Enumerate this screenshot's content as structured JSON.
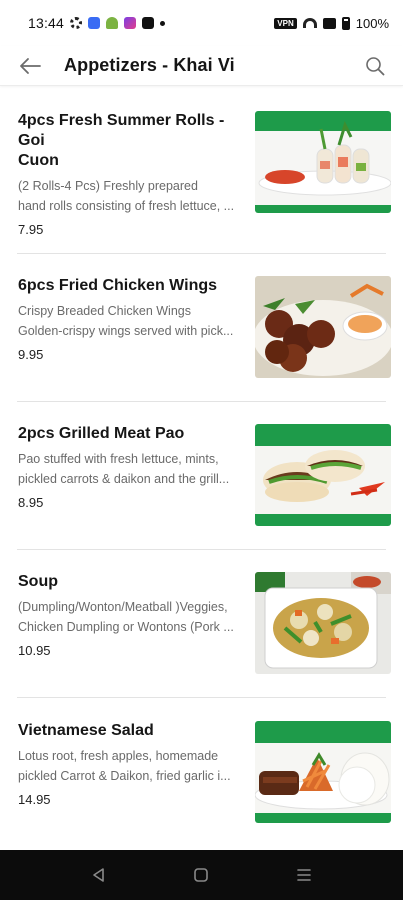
{
  "status_bar": {
    "time": "13:44",
    "vpn": "VPN",
    "battery": "100%"
  },
  "header": {
    "title": "Appetizers - Khai Vi",
    "icons": {
      "back": "arrow-left-icon",
      "search": "search-icon"
    }
  },
  "items": [
    {
      "title_lines": [
        "4pcs Fresh Summer Rolls - Goi",
        "Cuon"
      ],
      "desc_lines": [
        "(2 Rolls-4 Pcs) Freshly prepared",
        "hand rolls consisting of fresh lettuce, ..."
      ],
      "price": "7.95"
    },
    {
      "title_lines": [
        "6pcs Fried Chicken Wings"
      ],
      "desc_lines": [
        "Crispy Breaded Chicken Wings",
        "Golden-crispy wings served with pick..."
      ],
      "price": "9.95"
    },
    {
      "title_lines": [
        "2pcs Grilled Meat Pao"
      ],
      "desc_lines": [
        "Pao stuffed with fresh lettuce, mints,",
        "pickled carrots & daikon and the grill..."
      ],
      "price": "8.95"
    },
    {
      "title_lines": [
        "Soup"
      ],
      "desc_lines": [
        "(Dumpling/Wonton/Meatball )Veggies,",
        "Chicken Dumpling or Wontons (Pork ..."
      ],
      "price": "10.95"
    },
    {
      "title_lines": [
        "Vietnamese Salad"
      ],
      "desc_lines": [
        "Lotus root, fresh apples, homemade",
        "pickled Carrot & Daikon, fried garlic i..."
      ],
      "price": "14.95"
    }
  ],
  "colors": {
    "brand_green": "#1e9b4a",
    "nav_bar": "#0c0c0c"
  },
  "nav_icons": [
    "back-triangle-icon",
    "home-square-icon",
    "recents-lines-icon"
  ]
}
